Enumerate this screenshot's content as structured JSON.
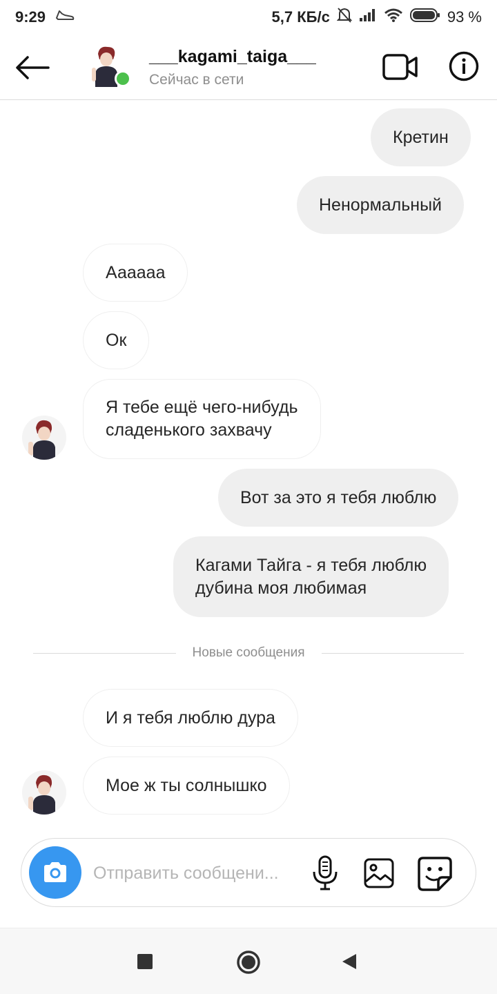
{
  "status_bar": {
    "time": "9:29",
    "network_speed": "5,7 КБ/с",
    "battery": "93 %"
  },
  "header": {
    "username": "___kagami_taiga___",
    "status": "Сейчас в сети"
  },
  "messages": [
    {
      "text": "Кретин",
      "direction": "outgoing"
    },
    {
      "text": "Ненормальный",
      "direction": "outgoing"
    },
    {
      "text": "Аааааа",
      "direction": "incoming"
    },
    {
      "text": "Ок",
      "direction": "incoming"
    },
    {
      "text_lines": [
        "Я тебе ещё чего-нибудь",
        "сладенького захвачу"
      ],
      "direction": "incoming"
    },
    {
      "text": "Вот за это я тебя люблю",
      "direction": "outgoing"
    },
    {
      "text_lines": [
        "Кагами Тайга - я тебя люблю",
        "дубина моя любимая"
      ],
      "direction": "outgoing"
    },
    {
      "text": "И я тебя люблю дура",
      "direction": "incoming"
    },
    {
      "text": "Мое ж ты солнышко",
      "direction": "incoming"
    }
  ],
  "divider": {
    "label": "Новые сообщения"
  },
  "composer": {
    "placeholder": "Отправить сообщени..."
  },
  "colors": {
    "accent": "#3797f0",
    "online": "#4cc04c",
    "outgoing_bubble": "#efefef"
  }
}
